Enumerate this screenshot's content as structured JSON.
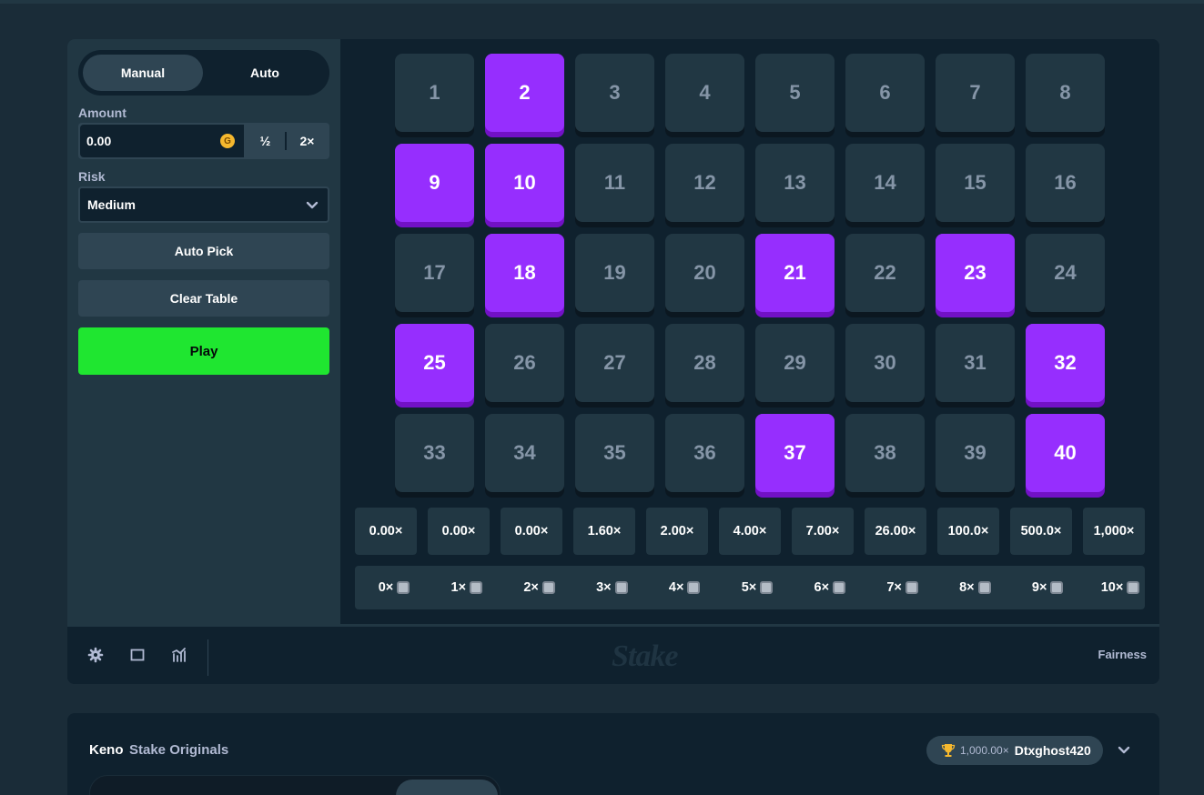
{
  "sidebar": {
    "tabs": [
      "Manual",
      "Auto"
    ],
    "amount_label": "Amount",
    "amount_value": "0.00",
    "currency_symbol": "G",
    "half_label": "½",
    "double_label": "2×",
    "risk_label": "Risk",
    "risk_value": "Medium",
    "auto_pick_label": "Auto Pick",
    "clear_table_label": "Clear Table",
    "play_label": "Play"
  },
  "board": {
    "tiles": [
      "1",
      "2",
      "3",
      "4",
      "5",
      "6",
      "7",
      "8",
      "9",
      "10",
      "11",
      "12",
      "13",
      "14",
      "15",
      "16",
      "17",
      "18",
      "19",
      "20",
      "21",
      "22",
      "23",
      "24",
      "25",
      "26",
      "27",
      "28",
      "29",
      "30",
      "31",
      "32",
      "33",
      "34",
      "35",
      "36",
      "37",
      "38",
      "39",
      "40"
    ],
    "picked": [
      2,
      9,
      10,
      18,
      21,
      23,
      25,
      32,
      37,
      40
    ],
    "multipliers": [
      "0.00×",
      "0.00×",
      "0.00×",
      "1.60×",
      "2.00×",
      "4.00×",
      "7.00×",
      "26.00×",
      "100.0×",
      "500.0×",
      "1,000×"
    ],
    "hits": [
      "0×",
      "1×",
      "2×",
      "3×",
      "4×",
      "5×",
      "6×",
      "7×",
      "8×",
      "9×",
      "10×"
    ]
  },
  "footer": {
    "logo": "Stake",
    "fairness_label": "Fairness",
    "icons": [
      "gear-icon",
      "theatre-mode-icon",
      "stats-icon"
    ]
  },
  "info": {
    "title": "Keno",
    "subtitle": "Stake Originals",
    "top_multiplier": "1,000.00×",
    "top_user": "Dtxghost420"
  },
  "colors": {
    "background": "#1a2c38",
    "panel": "#213743",
    "picked_tile": "#962efe",
    "play_button": "#1fe630"
  }
}
